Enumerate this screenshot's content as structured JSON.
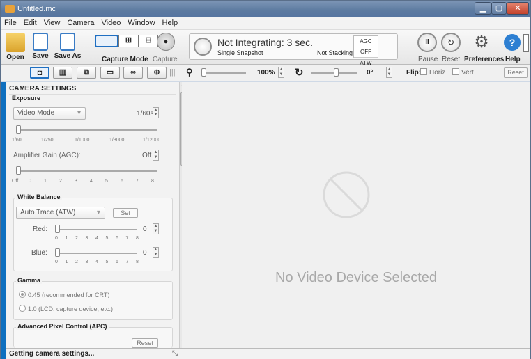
{
  "window": {
    "title": "Untitled.mc"
  },
  "menu": [
    "File",
    "Edit",
    "View",
    "Camera",
    "Video",
    "Window",
    "Help"
  ],
  "toolbar": {
    "open": "Open",
    "save": "Save",
    "save_as": "Save As",
    "capture_mode": "Capture Mode",
    "capture": "Capture",
    "status_main": "Not Integrating: 3 sec.",
    "status_sub": "Single Snapshot",
    "stacking": "Not Stacking",
    "agc": "AGC OFF",
    "atw": "ATW",
    "pause": "Pause",
    "reset": "Reset",
    "preferences": "Preferences",
    "help": "Help"
  },
  "secondbar": {
    "zoom": "100%",
    "rotate": "0°",
    "flip_label": "Flip:",
    "flip_h": "Horiz",
    "flip_v": "Vert",
    "reset": "Reset"
  },
  "camera_settings": {
    "title": "CAMERA SETTINGS",
    "exposure": {
      "label": "Exposure",
      "mode": "Video Mode",
      "value": "1/60s",
      "ticks": [
        "1/60",
        "1/250",
        "1/1000",
        "1/3000",
        "1/12000"
      ],
      "gain_label": "Amplifier Gain (AGC):",
      "gain_value": "Off",
      "gain_ticks": [
        "Off",
        "0",
        "1",
        "2",
        "3",
        "4",
        "5",
        "6",
        "7",
        "8"
      ]
    },
    "white_balance": {
      "label": "White Balance",
      "mode": "Auto Trace (ATW)",
      "set": "Set",
      "red_label": "Red:",
      "red_value": "0",
      "blue_label": "Blue:",
      "blue_value": "0",
      "ticks": [
        "0",
        "1",
        "2",
        "3",
        "4",
        "5",
        "6",
        "7",
        "8"
      ]
    },
    "gamma": {
      "label": "Gamma",
      "opt1": "0.45 (recommended for CRT)",
      "opt2": "1.0 (LCD, capture device, etc.)"
    },
    "apc": {
      "label": "Advanced Pixel Control (APC)",
      "reset": "Reset"
    }
  },
  "main": {
    "message": "No Video Device Selected"
  },
  "statusbar": {
    "text": "Getting camera settings..."
  }
}
